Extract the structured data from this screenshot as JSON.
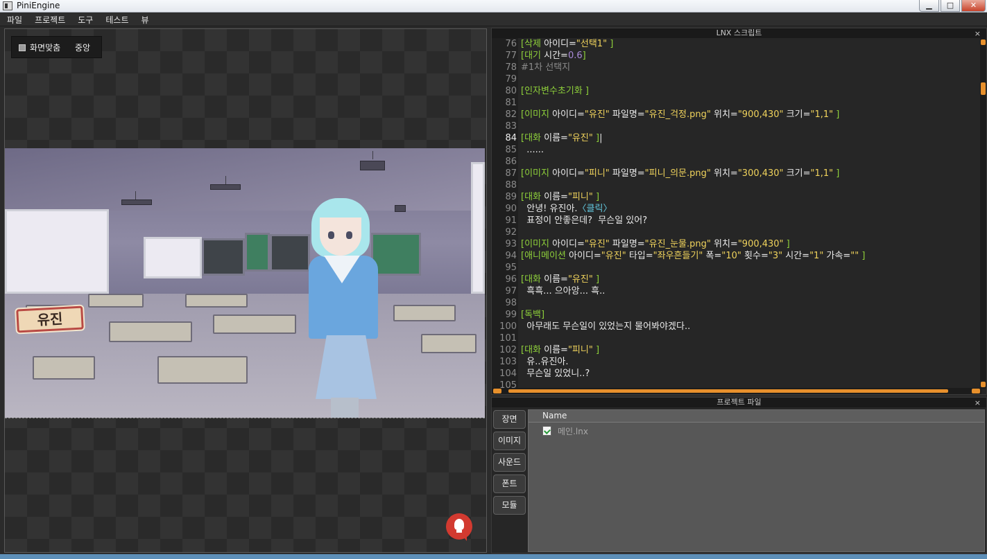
{
  "window": {
    "title": "PiniEngine",
    "min_glyph": "▁",
    "max_glyph": "□",
    "close_glyph": "✕"
  },
  "menu": {
    "items": [
      "파일",
      "프로젝트",
      "도구",
      "테스트",
      "뷰"
    ]
  },
  "viewport": {
    "fit_label": "화면맞춤",
    "center_label": "중앙",
    "name_tag": "유진"
  },
  "script_panel": {
    "title": "LNX 스크립트",
    "close": "×",
    "current_line": "84"
  },
  "project_panel": {
    "title": "프로젝트 파일",
    "close": "×",
    "tabs": [
      "장면",
      "이미지",
      "사운드",
      "폰트",
      "모듈"
    ],
    "column_name": "Name",
    "files": [
      "메인.lnx"
    ]
  },
  "colors": {
    "keyword": "#8fd13a",
    "string": "#f0d35c",
    "number": "#a98ad8",
    "scroll_accent": "#e7902c",
    "hint_button": "#d23a30"
  }
}
